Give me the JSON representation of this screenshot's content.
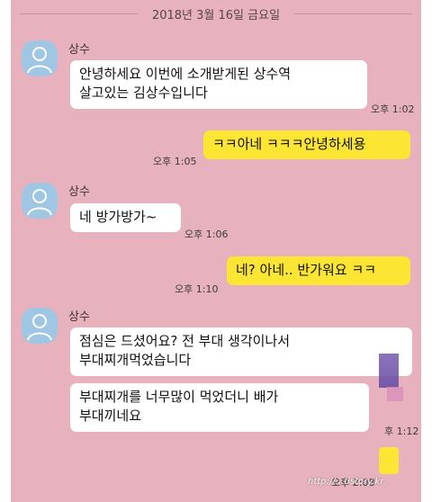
{
  "date_header": "2018년 3월 16일 금요일",
  "sender_name": "상수",
  "messages": [
    {
      "text": "안녕하세요 이번에 소개받게된 상수역\n살고있는 김상수입니다",
      "time": "오후 1:02"
    },
    {
      "text": "ㅋㅋ아네 ㅋㅋㅋ안녕하세용",
      "time": "오후 1:05"
    },
    {
      "text": "네 방가방가~",
      "time": "오후 1:06"
    },
    {
      "text": "네? 아네.. 반가워요 ㅋㅋ",
      "time": "오후 1:10"
    },
    {
      "text": "점심은 드셨어요? 전 부대 생각이나서\n부대찌개먹었습니다",
      "time": ""
    },
    {
      "text": "부대찌개를 너무많이 먹었더니 배가\n부대끼네요",
      "time": "후 1:12"
    },
    {
      "text": "",
      "time": "오후 2:08"
    }
  ],
  "watermark": "http://...tistory.kr",
  "colors": {
    "background": "#e7b2bd",
    "incoming": "#ffffff",
    "outgoing": "#fce533"
  },
  "icons": {
    "avatar": "default-profile-icon"
  }
}
